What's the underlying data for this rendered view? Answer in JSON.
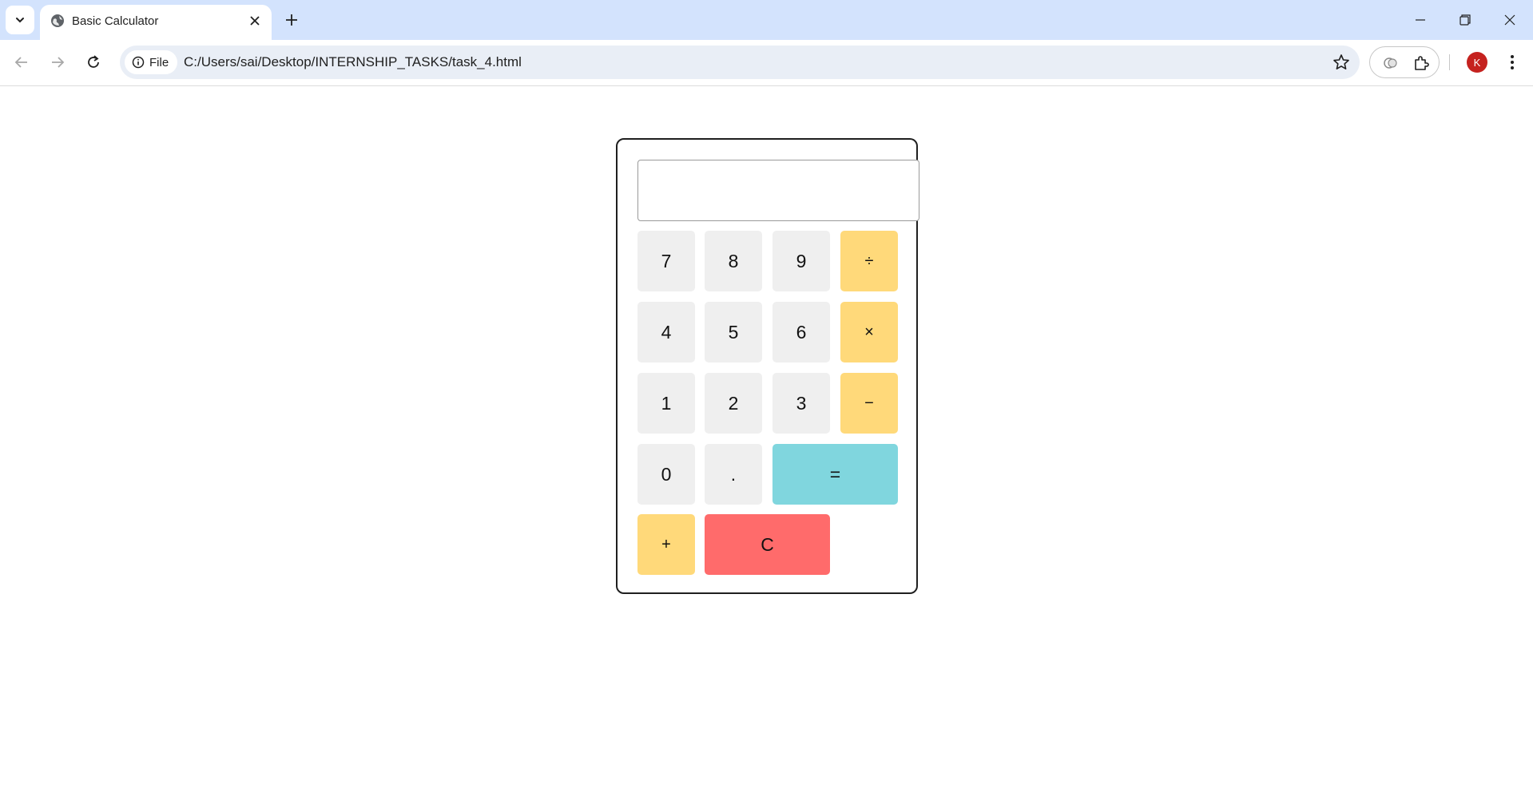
{
  "browser": {
    "tab_title": "Basic Calculator",
    "site_chip_label": "File",
    "url": "C:/Users/sai/Desktop/INTERNSHIP_TASKS/task_4.html",
    "profile_initial": "K",
    "profile_color": "#c5221f"
  },
  "calculator": {
    "display_value": "",
    "keys": {
      "seven": "7",
      "eight": "8",
      "nine": "9",
      "divide": "÷",
      "four": "4",
      "five": "5",
      "six": "6",
      "multiply": "×",
      "one": "1",
      "two": "2",
      "three": "3",
      "subtract": "−",
      "zero": "0",
      "decimal": ".",
      "equals": "=",
      "add": "+",
      "clear": "C"
    },
    "colors": {
      "number_key": "#efefef",
      "operator_key": "#ffd97a",
      "equals_key": "#80d6de",
      "clear_key": "#ff6b6b"
    }
  }
}
